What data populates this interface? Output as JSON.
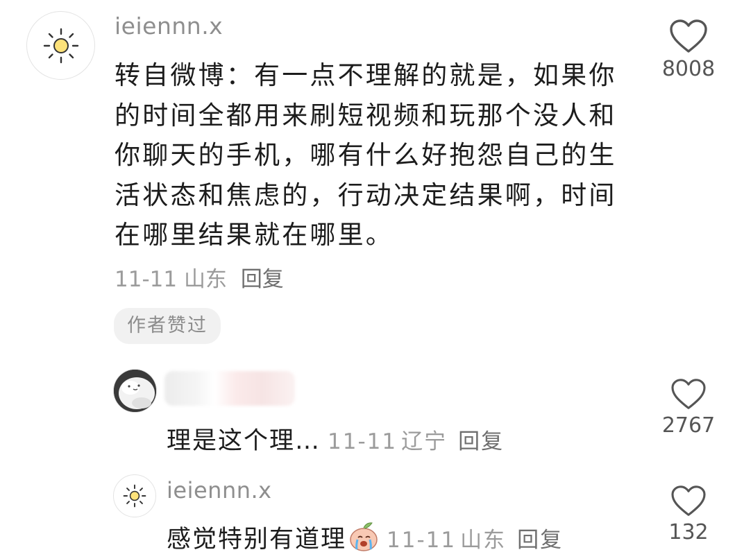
{
  "comment": {
    "username": "ieiennn.x",
    "text": "转自微博：有一点不理解的就是，如果你的时间全都用来刷短视频和玩那个没人和你聊天的手机，哪有什么好抱怨自己的生活状态和焦虑的，行动决定结果啊，时间在哪里结果就在哪里。",
    "date": "11-11",
    "location": "山东",
    "reply_label": "回复",
    "badge": "作者赞过",
    "like_count": "8008",
    "avatar_icon": "sun-icon",
    "like_icon": "heart-outline-icon"
  },
  "replies": [
    {
      "username": "",
      "text": "理是这个理…",
      "date": "11-11",
      "location": "辽宁",
      "reply_label": "回复",
      "like_count": "2767",
      "avatar_icon": "white-cat-avatar"
    },
    {
      "username": "ieiennn.x",
      "text": "感觉特别有道理",
      "emoji_icon": "crying-peach-emoji-icon",
      "date": "11-11",
      "location": "山东",
      "reply_label": "回复",
      "like_count": "132",
      "avatar_icon": "sun-icon"
    }
  ],
  "colors": {
    "meta_text": "#9b9b9b",
    "badge_bg": "#f1f1f1",
    "heart_stroke": "#555555"
  }
}
